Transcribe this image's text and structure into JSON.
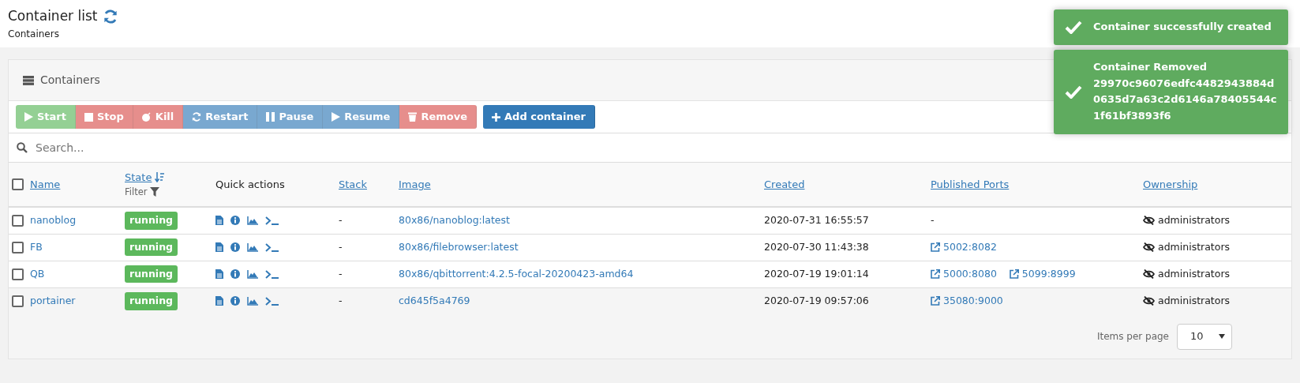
{
  "header": {
    "title": "Container list",
    "subtitle": "Containers"
  },
  "panel": {
    "title": "Containers"
  },
  "actions": [
    {
      "label": "Start",
      "kind": "success",
      "disabled": true
    },
    {
      "label": "Stop",
      "kind": "danger",
      "disabled": true
    },
    {
      "label": "Kill",
      "kind": "danger",
      "disabled": true
    },
    {
      "label": "Restart",
      "kind": "primary",
      "disabled": true
    },
    {
      "label": "Pause",
      "kind": "primary",
      "disabled": true
    },
    {
      "label": "Resume",
      "kind": "primary",
      "disabled": true
    },
    {
      "label": "Remove",
      "kind": "danger",
      "disabled": true
    },
    {
      "label": "Add container",
      "kind": "primary",
      "disabled": false
    }
  ],
  "search": {
    "placeholder": "Search..."
  },
  "table": {
    "select_all_checked": false,
    "columns": [
      {
        "label": "Name",
        "sortable": true
      },
      {
        "label": "State",
        "sortable": true,
        "sorted": true,
        "filter": "Filter"
      },
      {
        "label": "Quick actions",
        "sortable": false
      },
      {
        "label": "Stack",
        "sortable": true
      },
      {
        "label": "Image",
        "sortable": true
      },
      {
        "label": "Created",
        "sortable": true
      },
      {
        "label": "Published Ports",
        "sortable": true
      },
      {
        "label": "Ownership",
        "sortable": true
      }
    ],
    "rows": [
      {
        "checked": false,
        "name": "nanoblog",
        "state": "running",
        "stack": "-",
        "image": "80x86/nanoblog:latest",
        "created": "2020-07-31 16:55:57",
        "ports": [],
        "ports_empty": "-",
        "ownership": "administrators",
        "hovered": false
      },
      {
        "checked": false,
        "name": "FB",
        "state": "running",
        "stack": "-",
        "image": "80x86/filebrowser:latest",
        "created": "2020-07-30 11:43:38",
        "ports": [
          "5002:8082"
        ],
        "ownership": "administrators",
        "hovered": false
      },
      {
        "checked": false,
        "name": "QB",
        "state": "running",
        "stack": "-",
        "image": "80x86/qbittorrent:4.2.5-focal-20200423-amd64",
        "created": "2020-07-19 19:01:14",
        "ports": [
          "5000:8080",
          "5099:8999"
        ],
        "ownership": "administrators",
        "hovered": false
      },
      {
        "checked": false,
        "name": "portainer",
        "state": "running",
        "stack": "-",
        "image": "cd645f5a4769",
        "created": "2020-07-19 09:57:06",
        "ports": [
          "35080:9000"
        ],
        "ownership": "administrators",
        "hovered": true
      }
    ]
  },
  "pagination": {
    "label": "Items per page",
    "value": "10"
  },
  "toasts": [
    {
      "kind": "success",
      "title": "Container successfully created"
    },
    {
      "kind": "success",
      "title": "Container Removed",
      "message": "29970c96076edfc4482943884d0635d7a63c2d6146a78405544c1f61bf3893f6"
    }
  ]
}
